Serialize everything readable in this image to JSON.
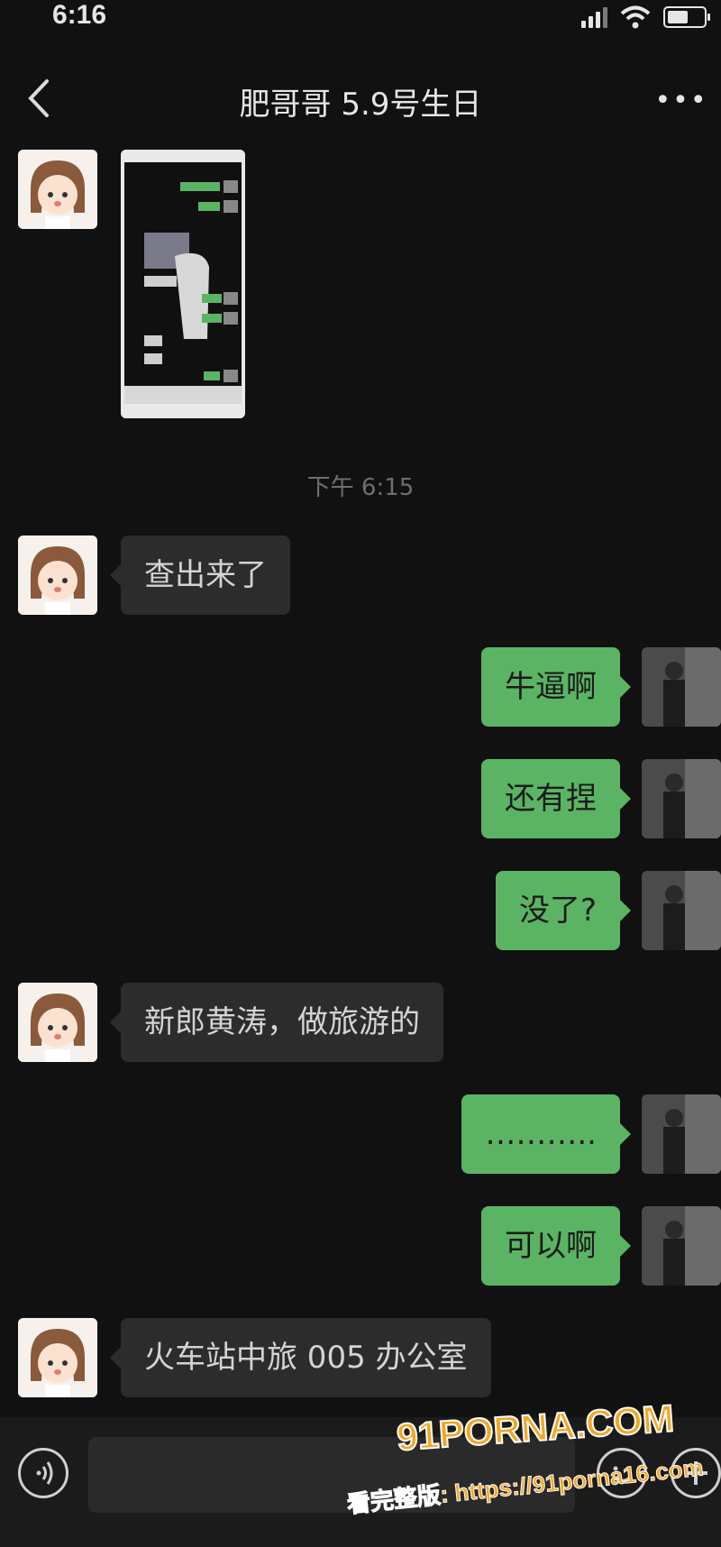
{
  "status_bar": {
    "time": "6:16"
  },
  "nav": {
    "title": "肥哥哥 5.9号生日",
    "more": "•••"
  },
  "timestamp": "下午 6:15",
  "messages": [
    {
      "side": "left",
      "text": "查出来了"
    },
    {
      "side": "right",
      "text": "牛逼啊"
    },
    {
      "side": "right",
      "text": "还有捏"
    },
    {
      "side": "right",
      "text": "没了?"
    },
    {
      "side": "left",
      "text": "新郎黄涛，做旅游的"
    },
    {
      "side": "right",
      "text": "……….."
    },
    {
      "side": "right",
      "text": "可以啊"
    },
    {
      "side": "left",
      "text": "火车站中旅 005 办公室"
    }
  ],
  "watermark": {
    "logo": "91PORNA.COM",
    "url": "看完整版: https://91porna16.com"
  },
  "colors": {
    "background": "#111111",
    "bubble_left": "#2c2c2c",
    "bubble_right": "#5bb464"
  },
  "icons": [
    "back-icon",
    "more-icon",
    "voice-icon",
    "emoji-icon",
    "plus-icon"
  ]
}
